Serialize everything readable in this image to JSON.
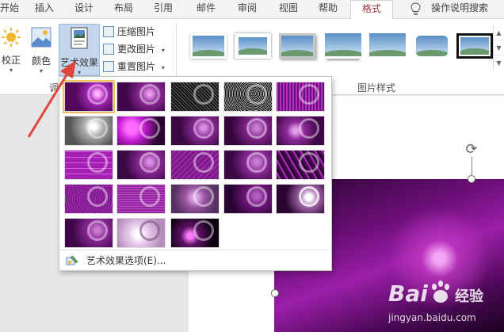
{
  "tabs": [
    "开始",
    "插入",
    "设计",
    "布局",
    "引用",
    "邮件",
    "审阅",
    "视图",
    "帮助",
    "格式"
  ],
  "active_tab": "格式",
  "search_label": "操作说明搜索",
  "ribbon": {
    "corrections": "校正",
    "color": "颜色",
    "artistic_effects": "艺术效果",
    "compress": "压缩图片",
    "change": "更改图片",
    "reset": "重置图片",
    "group_adjust": "调",
    "group_styles": "图片样式"
  },
  "dropdown": {
    "option_label": "艺术效果选项(E)..."
  },
  "colors": {
    "accent": "#a4373a",
    "selected": "#c5d7ee",
    "arrow": "#e0453a",
    "purple_dark": "#3a0842",
    "purple": "#8e1c9c"
  },
  "watermark": {
    "brand": "Bai",
    "brand_suffix": "经验",
    "url": "jingyan.baidu.com"
  }
}
